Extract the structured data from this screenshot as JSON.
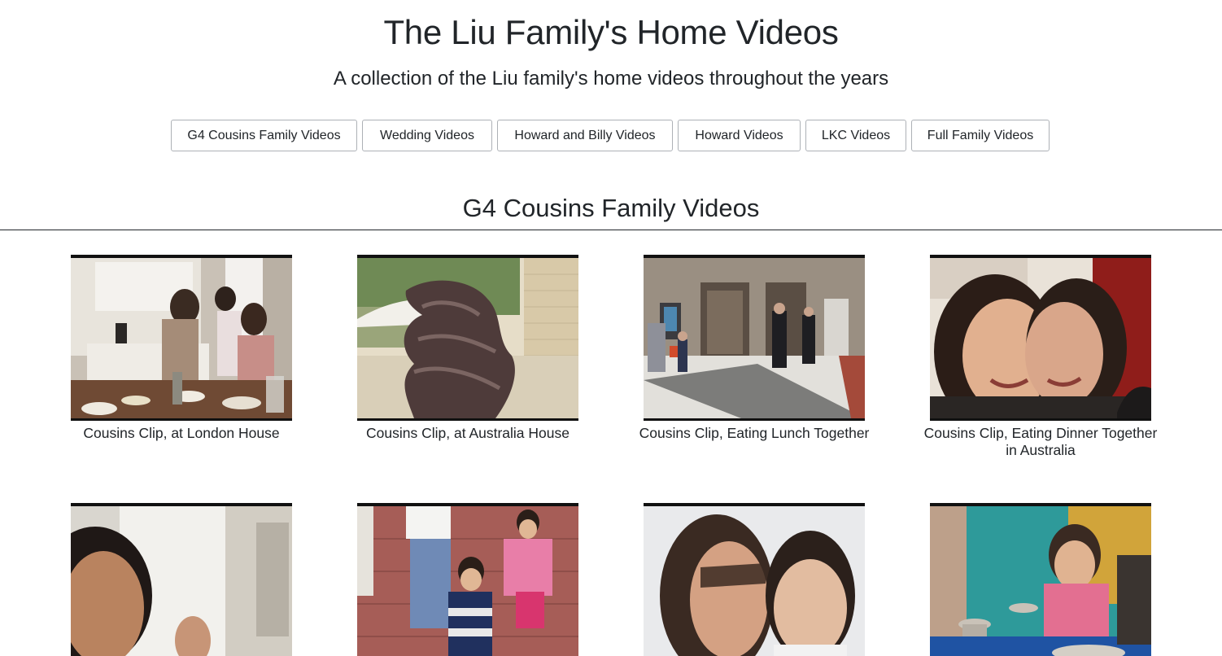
{
  "header": {
    "title": "The Liu Family's Home Videos",
    "subtitle": "A collection of the Liu family's home videos throughout the years"
  },
  "nav": {
    "buttons": [
      "G4 Cousins Family Videos",
      "Wedding Videos",
      "Howard and Billy Videos",
      "Howard Videos",
      "LKC Videos",
      "Full Family Videos"
    ]
  },
  "section": {
    "title": "G4 Cousins Family Videos"
  },
  "videos": [
    {
      "caption": "Cousins Clip, at London House",
      "thumbnail": "kitchen-table-scene"
    },
    {
      "caption": "Cousins Clip, at Australia House",
      "thumbnail": "sculpture-garden-scene"
    },
    {
      "caption": "Cousins Clip, Eating Lunch Together",
      "thumbnail": "lobby-doors-scene"
    },
    {
      "caption": "Cousins Clip, Eating Dinner Together in Australia",
      "thumbnail": "two-women-smiling-scene"
    },
    {
      "caption": "",
      "thumbnail": "woman-closeup-scene"
    },
    {
      "caption": "",
      "thumbnail": "children-walking-scene"
    },
    {
      "caption": "",
      "thumbnail": "woman-and-boy-scene"
    },
    {
      "caption": "",
      "thumbnail": "girl-laughing-scene"
    }
  ]
}
